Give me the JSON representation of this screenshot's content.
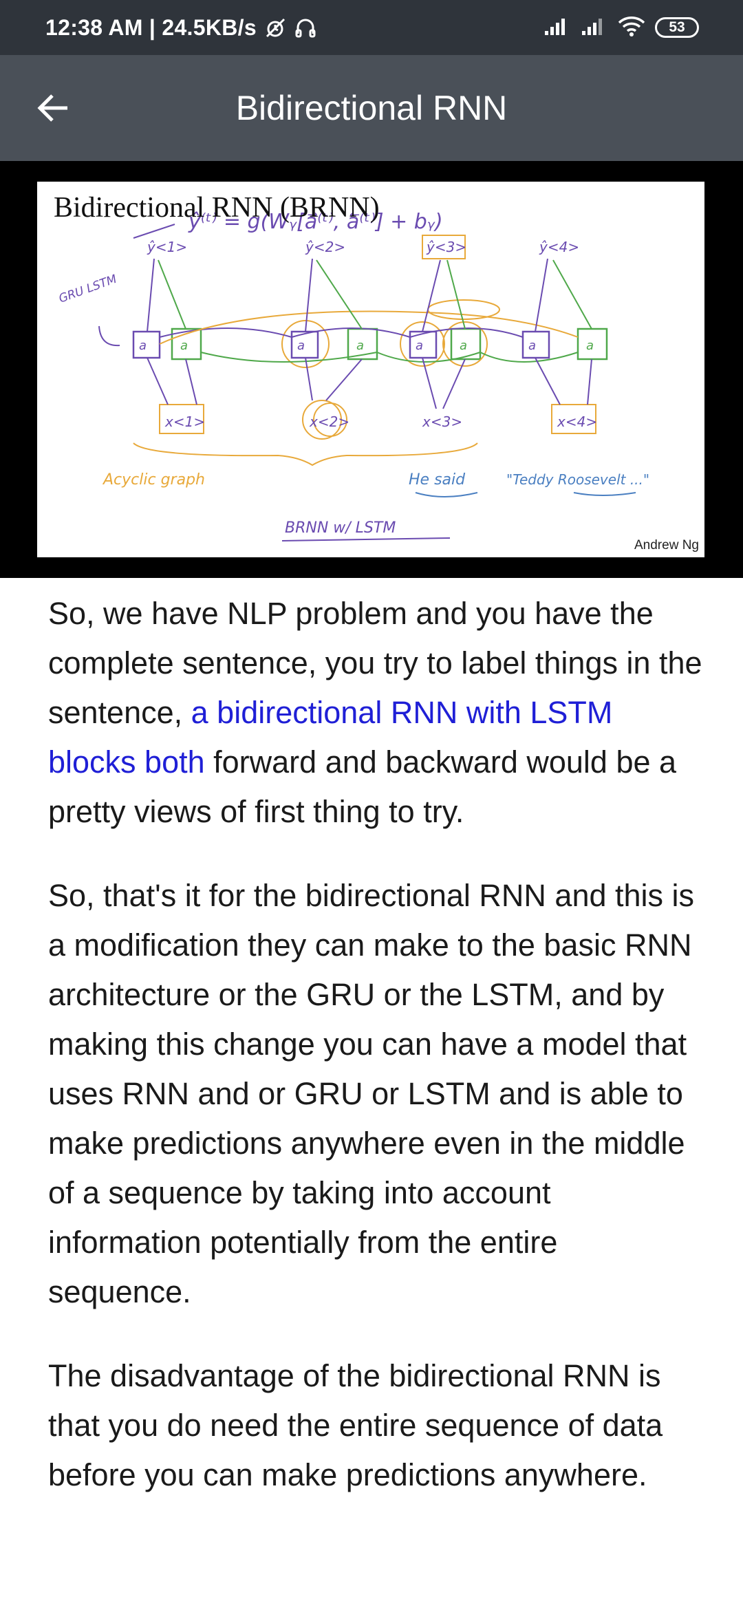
{
  "status_bar": {
    "time_speed": "12:38 AM | 24.5KB/s",
    "battery": "53"
  },
  "app_bar": {
    "title": "Bidirectional RNN"
  },
  "slide": {
    "title": "Bidirectional RNN (BRNN)",
    "author": "Andrew Ng",
    "formula": "ŷ⁽ᵗ⁾ = g(Wᵧ[a⃗⁽ᵗ⁾, a⃖⁽ᵗ⁾] + bᵧ)",
    "side_note": "GRU LSTM",
    "outputs": [
      "ŷ<1>",
      "ŷ<2>",
      "ŷ<3>",
      "ŷ<4>"
    ],
    "inputs": [
      "x<1>",
      "x<2>",
      "x<3>",
      "x<4>"
    ],
    "note_left": "Acyclic graph",
    "note_he_said": "He said",
    "note_teddy": "\"Teddy Roosevelt ...\"",
    "note_bottom": "BRNN w/ LSTM"
  },
  "content": {
    "p1_before": "So, we have NLP problem and you have the complete sentence, you try to label things in the sentence, ",
    "p1_highlight": "a bidirectional RNN with LSTM blocks both",
    "p1_after": " forward and backward would be a pretty views of first thing to try.",
    "p2": "So, that's it for the bidirectional RNN and this is a modification they can make to the basic RNN architecture or the GRU or the LSTM, and by making this change you can have a model that uses RNN and or GRU or LSTM and is able to make predictions anywhere even in the middle of a se­quence by taking into account information potentially from the entire sequence.",
    "p3": "The disadvantage of the bidirectional RNN is that you do need the entire sequence of data before you can make predictions anywhere."
  },
  "colors": {
    "status_bar": "#2f343b",
    "app_bar": "#4a5058",
    "highlight": "#1f1fd6",
    "ink_purple": "#6a4bb0",
    "ink_green": "#4fa84a",
    "ink_orange": "#e8a93a"
  }
}
